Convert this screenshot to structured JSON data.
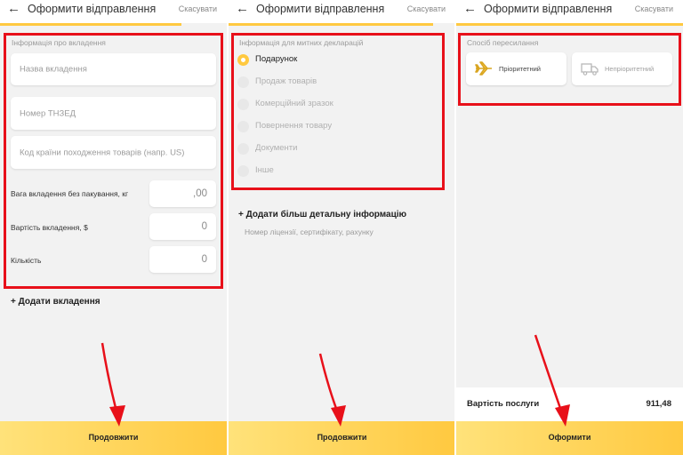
{
  "colors": {
    "accent": "#ffc940",
    "highlight": "#e8101a"
  },
  "screens": [
    {
      "title": "Оформити відправлення",
      "cancel": "Скасувати",
      "progress": 0.8,
      "section": "Інформація про вкладення",
      "fields": [
        {
          "placeholder": "Назва вкладення"
        },
        {
          "placeholder": "Номер ТНЗЕД"
        },
        {
          "placeholder": "Код країни походження товарів (напр. US)"
        }
      ],
      "numeric_rows": [
        {
          "label": "Вага вкладення без пакування, кг",
          "value": ",00"
        },
        {
          "label": "Вартість вкладення, $",
          "value": "0"
        },
        {
          "label": "Кількість",
          "value": "0"
        }
      ],
      "add_link": "+ Додати вкладення",
      "button": "Продовжити"
    },
    {
      "title": "Оформити відправлення",
      "cancel": "Скасувати",
      "progress": 0.9,
      "section": "Інформація для митних декларацій",
      "options": [
        {
          "label": "Подарунок",
          "selected": true
        },
        {
          "label": "Продаж товарів",
          "selected": false
        },
        {
          "label": "Комерційний зразок",
          "selected": false
        },
        {
          "label": "Повернення товару",
          "selected": false
        },
        {
          "label": "Документи",
          "selected": false
        },
        {
          "label": "Інше",
          "selected": false
        }
      ],
      "add_link": "+ Додати більш детальну інформацію",
      "hint": "Номер ліцензії, сертифікату, рахунку",
      "button": "Продовжити"
    },
    {
      "title": "Оформити відправлення",
      "cancel": "Скасувати",
      "progress": 1.0,
      "section": "Спосіб пересилання",
      "methods": [
        {
          "label": "Пріоритетний",
          "icon": "airplane-icon",
          "active": true
        },
        {
          "label": "Непріоритетний",
          "icon": "truck-icon",
          "active": false
        }
      ],
      "cost_label": "Вартість послуги",
      "cost_value": "911,48",
      "button": "Оформити"
    }
  ]
}
